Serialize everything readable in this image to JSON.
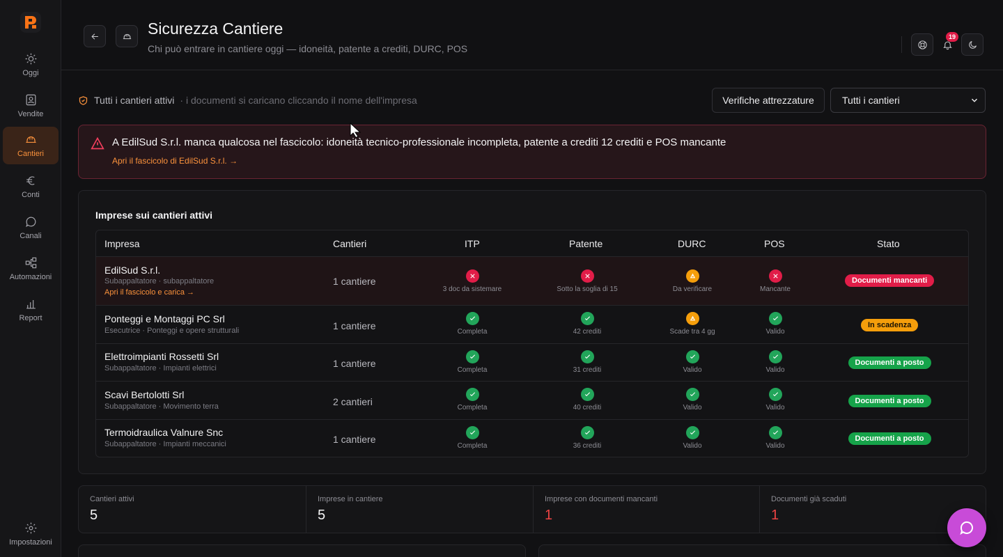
{
  "sidebar": {
    "items": [
      {
        "label": "Oggi"
      },
      {
        "label": "Vendite"
      },
      {
        "label": "Cantieri"
      },
      {
        "label": "Conti"
      },
      {
        "label": "Canali"
      },
      {
        "label": "Automazioni"
      },
      {
        "label": "Report"
      }
    ],
    "settings_label": "Impostazioni",
    "active_index": 2
  },
  "header": {
    "title": "Sicurezza Cantiere",
    "subtitle": "Chi può entrare in cantiere oggi — idoneità, patente a crediti, DURC, POS",
    "notifications_count": "19"
  },
  "filter": {
    "scope_label": "Tutti i cantieri attivi",
    "hint": "· i documenti si caricano cliccando il nome dell'impresa",
    "equipment_button": "Verifiche attrezzature",
    "site_select_value": "Tutti i cantieri"
  },
  "alert": {
    "message": "A EdilSud S.r.l. manca qualcosa nel fascicolo: idoneità tecnico-professionale incompleta, patente a crediti 12 crediti e POS mancante",
    "link": "Apri il fascicolo di EdilSud S.r.l. →"
  },
  "table": {
    "title": "Imprese sui cantieri attivi",
    "columns": [
      "Impresa",
      "Cantieri",
      "ITP",
      "Patente",
      "DURC",
      "POS",
      "Stato"
    ],
    "rows": [
      {
        "name": "EdilSud S.r.l.",
        "meta": "Subappaltatore · subappaltatore",
        "link": "Apri il fascicolo e carica →",
        "sites": "1 cantiere",
        "itp": {
          "state": "bad",
          "label": "3 doc da sistemare"
        },
        "patente": {
          "state": "bad",
          "label": "Sotto la soglia di 15"
        },
        "durc": {
          "state": "warn",
          "label": "Da verificare"
        },
        "pos": {
          "state": "bad",
          "label": "Mancante"
        },
        "status": {
          "label": "Documenti mancanti",
          "tone": "red"
        }
      },
      {
        "name": "Ponteggi e Montaggi PC Srl",
        "meta": "Esecutrice · Ponteggi e opere strutturali",
        "sites": "1 cantiere",
        "itp": {
          "state": "ok",
          "label": "Completa"
        },
        "patente": {
          "state": "ok",
          "label": "42 crediti"
        },
        "durc": {
          "state": "warn",
          "label": "Scade tra 4 gg"
        },
        "pos": {
          "state": "ok",
          "label": "Valido"
        },
        "status": {
          "label": "In scadenza",
          "tone": "amber"
        }
      },
      {
        "name": "Elettroimpianti Rossetti Srl",
        "meta": "Subappaltatore · Impianti elettrici",
        "sites": "1 cantiere",
        "itp": {
          "state": "ok",
          "label": "Completa"
        },
        "patente": {
          "state": "ok",
          "label": "31 crediti"
        },
        "durc": {
          "state": "ok",
          "label": "Valido"
        },
        "pos": {
          "state": "ok",
          "label": "Valido"
        },
        "status": {
          "label": "Documenti a posto",
          "tone": "green"
        }
      },
      {
        "name": "Scavi Bertolotti Srl",
        "meta": "Subappaltatore · Movimento terra",
        "sites": "2 cantieri",
        "itp": {
          "state": "ok",
          "label": "Completa"
        },
        "patente": {
          "state": "ok",
          "label": "40 crediti"
        },
        "durc": {
          "state": "ok",
          "label": "Valido"
        },
        "pos": {
          "state": "ok",
          "label": "Valido"
        },
        "status": {
          "label": "Documenti a posto",
          "tone": "green"
        }
      },
      {
        "name": "Termoidraulica Valnure Snc",
        "meta": "Subappaltatore · Impianti meccanici",
        "sites": "1 cantiere",
        "itp": {
          "state": "ok",
          "label": "Completa"
        },
        "patente": {
          "state": "ok",
          "label": "36 crediti"
        },
        "durc": {
          "state": "ok",
          "label": "Valido"
        },
        "pos": {
          "state": "ok",
          "label": "Valido"
        },
        "status": {
          "label": "Documenti a posto",
          "tone": "green"
        }
      }
    ]
  },
  "stats": [
    {
      "label": "Cantieri attivi",
      "value": "5",
      "tone": "default"
    },
    {
      "label": "Imprese in cantiere",
      "value": "5",
      "tone": "default"
    },
    {
      "label": "Imprese con documenti mancanti",
      "value": "1",
      "tone": "red"
    },
    {
      "label": "Documenti già scaduti",
      "value": "1",
      "tone": "red"
    }
  ],
  "colors": {
    "accent": "#fb923c",
    "danger": "#e11d48",
    "warning": "#f59e0b",
    "success": "#22a55a",
    "chat": "#c84bd8"
  }
}
